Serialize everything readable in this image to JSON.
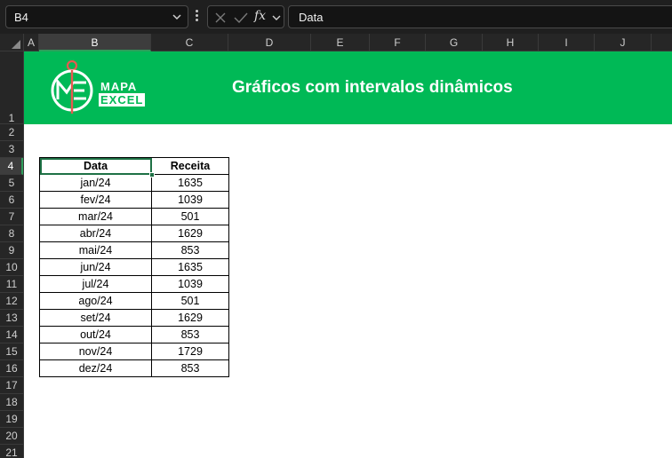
{
  "formula_bar": {
    "name_box": "B4",
    "fx_label": "fx",
    "formula_value": "Data"
  },
  "columns": [
    {
      "label": "A",
      "selected": false
    },
    {
      "label": "B",
      "selected": true
    },
    {
      "label": "C",
      "selected": false
    },
    {
      "label": "D",
      "selected": false
    },
    {
      "label": "E",
      "selected": false
    },
    {
      "label": "F",
      "selected": false
    },
    {
      "label": "G",
      "selected": false
    },
    {
      "label": "H",
      "selected": false
    },
    {
      "label": "I",
      "selected": false
    },
    {
      "label": "J",
      "selected": false
    }
  ],
  "rows": [
    "1",
    "2",
    "3",
    "4",
    "5",
    "6",
    "7",
    "8",
    "9",
    "10",
    "11",
    "12",
    "13",
    "14",
    "15",
    "16",
    "17",
    "18",
    "19",
    "20",
    "21"
  ],
  "selected_row": "4",
  "banner": {
    "logo_top": "MAPA",
    "logo_bottom": "EXCEL",
    "title": "Gráficos com intervalos dinâmicos"
  },
  "colors": {
    "banner_green": "#00b956",
    "selection_green": "#1e7145"
  },
  "table": {
    "headers": [
      "Data",
      "Receita"
    ],
    "rows": [
      [
        "jan/24",
        "1635"
      ],
      [
        "fev/24",
        "1039"
      ],
      [
        "mar/24",
        "501"
      ],
      [
        "abr/24",
        "1629"
      ],
      [
        "mai/24",
        "853"
      ],
      [
        "jun/24",
        "1635"
      ],
      [
        "jul/24",
        "1039"
      ],
      [
        "ago/24",
        "501"
      ],
      [
        "set/24",
        "1629"
      ],
      [
        "out/24",
        "853"
      ],
      [
        "nov/24",
        "1729"
      ],
      [
        "dez/24",
        "853"
      ]
    ]
  }
}
